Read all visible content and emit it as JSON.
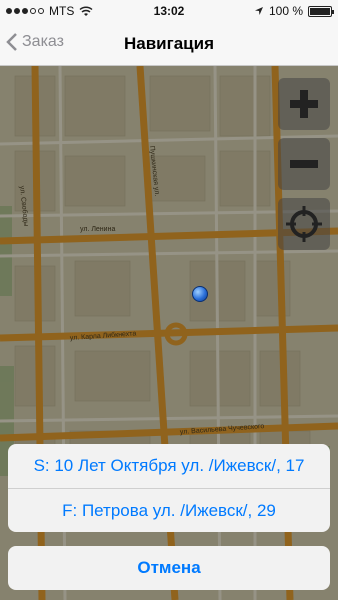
{
  "status_bar": {
    "carrier": "MTS",
    "time": "13:02",
    "battery": "100 %"
  },
  "nav": {
    "back_label": "Заказ",
    "title": "Навигация"
  },
  "map": {
    "street_labels": [
      "ул. Ленина",
      "ул. Карла Либкнехта",
      "ул. Васильева Чучевского",
      "Пушкинская ул.",
      "ул. Свободы"
    ]
  },
  "controls": {
    "zoom_in_icon": "plus-icon",
    "zoom_out_icon": "minus-icon",
    "locate_icon": "crosshair-icon"
  },
  "sheet": {
    "start": "S: 10 Лет Октября ул. /Ижевск/, 17",
    "finish": "F: Петрова ул. /Ижевск/, 29",
    "cancel": "Отмена"
  },
  "colors": {
    "accent": "#007aff",
    "road": "#e8a030",
    "map_bg": "#d6cfb0"
  }
}
